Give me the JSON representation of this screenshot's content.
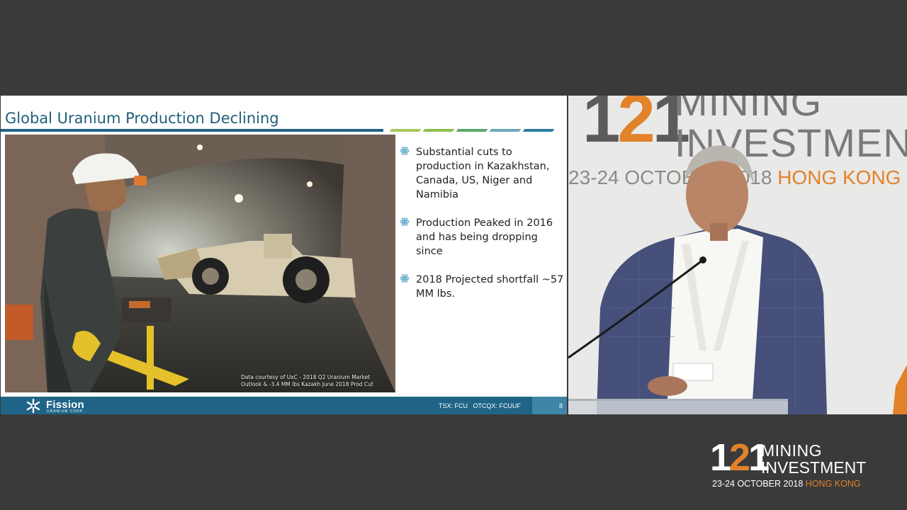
{
  "slide": {
    "title": "Global Uranium Production Declining",
    "photo_caption": "Data courtesy of UxC - 2018 Q2 Uranium Market Outlook & -3.4 MM lbs Kazakh June 2018 Prod Cut",
    "bullets": [
      "Substantial cuts to production in Kazakhstan, Canada, US, Niger and Namibia",
      "Production Peaked in 2016 and has being dropping since",
      "2018 Projected shortfall ~57 MM lbs."
    ],
    "footer": {
      "logo_name": "Fission",
      "logo_sub": "URANIUM CORP.",
      "ticker": "TSX: FCU   OTCQX: FCUUF",
      "page_number": "8"
    }
  },
  "backdrop": {
    "num_one": "1",
    "num_two": "2",
    "num_three": "1",
    "mining": "MINING",
    "investment": "INVESTMENT",
    "date_prefix": "23-24 OCTOBER 2018",
    "date_city": "HONG KONG"
  },
  "brand": {
    "num_one": "1",
    "num_two": "2",
    "num_three": "1",
    "mining": "MINING",
    "investment": "INVESTMENT",
    "date_prefix": "23-24 OCTOBER 2018",
    "date_city": "HONG KONG"
  },
  "colors": {
    "slide_blue": "#1f6487",
    "accent_orange": "#e2822a",
    "stage_bg": "#3a3a3a"
  }
}
